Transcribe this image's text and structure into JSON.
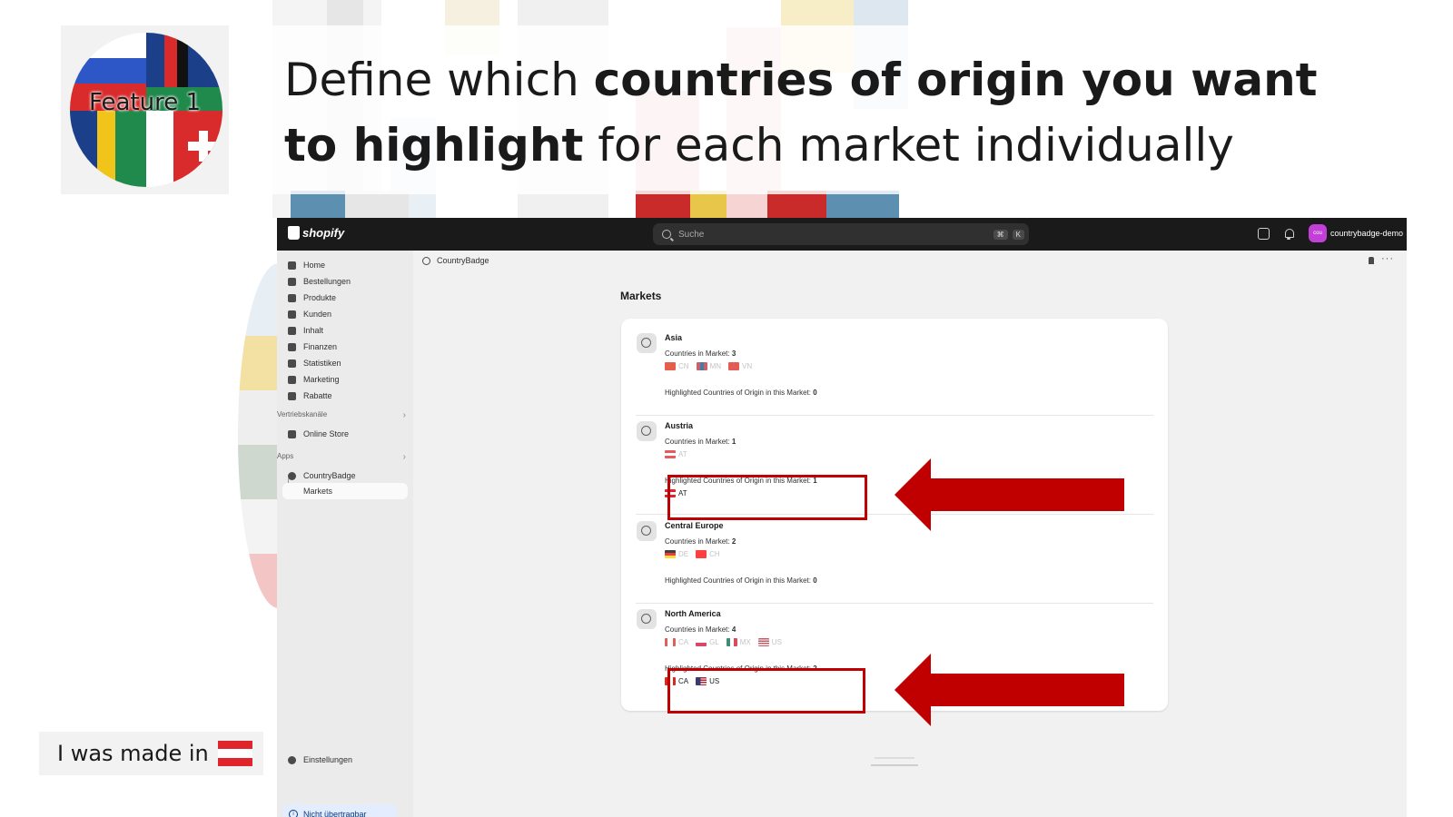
{
  "slide": {
    "feature_label": "Feature 1",
    "headline": {
      "part1": "Define which ",
      "bold1": "countries of origin you want to highlight",
      "part2": " for each market individually"
    },
    "made_in_text": "I was made in"
  },
  "topbar": {
    "logo_text": "shopify",
    "search_placeholder": "Suche",
    "shortcut_key1": "⌘",
    "shortcut_key2": "K",
    "store_avatar": "cou",
    "store_name": "countrybadge-demo"
  },
  "sidebar": {
    "items": [
      {
        "label": "Home",
        "icon": "home-icon"
      },
      {
        "label": "Bestellungen",
        "icon": "orders-icon"
      },
      {
        "label": "Produkte",
        "icon": "tag-icon"
      },
      {
        "label": "Kunden",
        "icon": "person-icon"
      },
      {
        "label": "Inhalt",
        "icon": "content-icon"
      },
      {
        "label": "Finanzen",
        "icon": "bank-icon"
      },
      {
        "label": "Statistiken",
        "icon": "chart-icon"
      },
      {
        "label": "Marketing",
        "icon": "target-icon"
      },
      {
        "label": "Rabatte",
        "icon": "discount-icon"
      }
    ],
    "sales_channels_heading": "Vertriebskanäle",
    "online_store": "Online Store",
    "apps_heading": "Apps",
    "app_name": "CountryBadge",
    "app_sub": "Markets",
    "settings": "Einstellungen",
    "not_transferable": "Nicht übertragbar"
  },
  "main": {
    "breadcrumb": "CountryBadge",
    "page_title": "Markets",
    "countries_label": "Countries in Market: ",
    "highlighted_label": "Highlighted Countries of Origin in this Market: ",
    "markets": [
      {
        "name": "Asia",
        "count": "3",
        "countries": [
          "CN",
          "MN",
          "VN"
        ],
        "highlighted_count": "0",
        "highlighted": []
      },
      {
        "name": "Austria",
        "count": "1",
        "countries": [
          "AT"
        ],
        "highlighted_count": "1",
        "highlighted": [
          "AT"
        ]
      },
      {
        "name": "Central Europe",
        "count": "2",
        "countries": [
          "DE",
          "CH"
        ],
        "highlighted_count": "0",
        "highlighted": []
      },
      {
        "name": "North America",
        "count": "4",
        "countries": [
          "CA",
          "GL",
          "MX",
          "US"
        ],
        "highlighted_count": "2",
        "highlighted": [
          "CA",
          "US"
        ]
      }
    ]
  },
  "colors": {
    "accent_red": "#c00000",
    "topbar": "#1a1a1a",
    "avatar": "#c23fd8"
  }
}
